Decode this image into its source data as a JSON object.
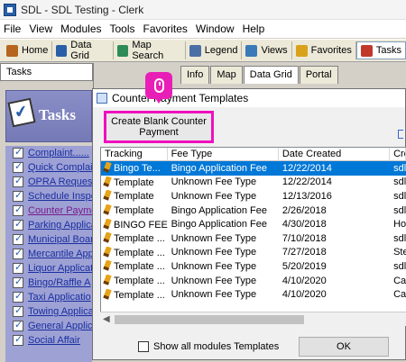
{
  "window": {
    "title": "SDL - SDL Testing - Clerk"
  },
  "menu": [
    {
      "label": "File",
      "key": "F"
    },
    {
      "label": "View",
      "key": "V"
    },
    {
      "label": "Modules",
      "key": "M"
    },
    {
      "label": "Tools",
      "key": "T"
    },
    {
      "label": "Favorites",
      "key": ""
    },
    {
      "label": "Window",
      "key": "W"
    },
    {
      "label": "Help",
      "key": "H"
    }
  ],
  "toolbar": [
    {
      "label": "Home",
      "icon": "home-icon"
    },
    {
      "label": "Data Grid",
      "icon": "grid-icon"
    },
    {
      "label": "Map Search",
      "icon": "globe-icon"
    },
    {
      "label": "Legend",
      "icon": "legend-icon"
    },
    {
      "label": "Views",
      "icon": "views-icon"
    },
    {
      "label": "Favorites",
      "icon": "star-icon"
    },
    {
      "label": "Tasks",
      "icon": "tasks-icon"
    }
  ],
  "left_pane": {
    "header": "Tasks",
    "banner": "Tasks",
    "items": [
      {
        "label": "Complaint......",
        "visited": false
      },
      {
        "label": "Quick Complain",
        "visited": false
      },
      {
        "label": "OPRA Request",
        "visited": false
      },
      {
        "label": "Schedule Inspe",
        "visited": false
      },
      {
        "label": "Counter Payme",
        "visited": true
      },
      {
        "label": "Parking Applica",
        "visited": false
      },
      {
        "label": "Municipal Boar",
        "visited": false
      },
      {
        "label": "Mercantile App",
        "visited": false
      },
      {
        "label": "Liquor Applicat",
        "visited": false
      },
      {
        "label": "Bingo/Raffle A",
        "visited": false
      },
      {
        "label": "Taxi Applicatio",
        "visited": false
      },
      {
        "label": "Towing Applica",
        "visited": false
      },
      {
        "label": "General Applic",
        "visited": false
      },
      {
        "label": "Social Affair",
        "visited": false
      }
    ]
  },
  "tabs": [
    {
      "label": "Info",
      "active": false
    },
    {
      "label": "Map",
      "active": false
    },
    {
      "label": "Data Grid",
      "active": true
    },
    {
      "label": "Portal",
      "active": false
    }
  ],
  "dialog": {
    "title": "Counter Payment Templates",
    "create_button_line1": "Create Blank Counter",
    "create_button_line2": "Payment",
    "columns": [
      "Tracking",
      "Fee Type",
      "Date Created",
      "Cre"
    ],
    "rows": [
      {
        "tracking": "Bingo Te...",
        "fee_type": "Bingo Application Fee",
        "date": "12/22/2014",
        "creator": "sdl",
        "selected": true
      },
      {
        "tracking": "Template",
        "fee_type": "Unknown Fee Type",
        "date": "12/22/2014",
        "creator": "sdl",
        "selected": false
      },
      {
        "tracking": "Template",
        "fee_type": "Unknown Fee Type",
        "date": "12/13/2016",
        "creator": "sdl",
        "selected": false
      },
      {
        "tracking": "Template",
        "fee_type": "Bingo Application Fee",
        "date": "2/26/2018",
        "creator": "sdl",
        "selected": false
      },
      {
        "tracking": "BINGO FEE",
        "fee_type": "Bingo Application Fee",
        "date": "4/30/2018",
        "creator": "Ho",
        "selected": false
      },
      {
        "tracking": "Template ...",
        "fee_type": "Unknown Fee Type",
        "date": "7/10/2018",
        "creator": "sdl",
        "selected": false
      },
      {
        "tracking": "Template ...",
        "fee_type": "Unknown Fee Type",
        "date": "7/27/2018",
        "creator": "Ste",
        "selected": false
      },
      {
        "tracking": "Template ...",
        "fee_type": "Unknown Fee Type",
        "date": "5/20/2019",
        "creator": "sdl",
        "selected": false
      },
      {
        "tracking": "Template ...",
        "fee_type": "Unknown Fee Type",
        "date": "4/10/2020",
        "creator": "Ca",
        "selected": false
      },
      {
        "tracking": "Template ...",
        "fee_type": "Unknown Fee Type",
        "date": "4/10/2020",
        "creator": "Ca",
        "selected": false
      }
    ],
    "show_all_label": "Show all modules Templates",
    "ok_label": "OK"
  },
  "colors": {
    "highlight": "#f00fbf",
    "selection": "#0078d7",
    "tasks_bg": "#9da1d4"
  }
}
